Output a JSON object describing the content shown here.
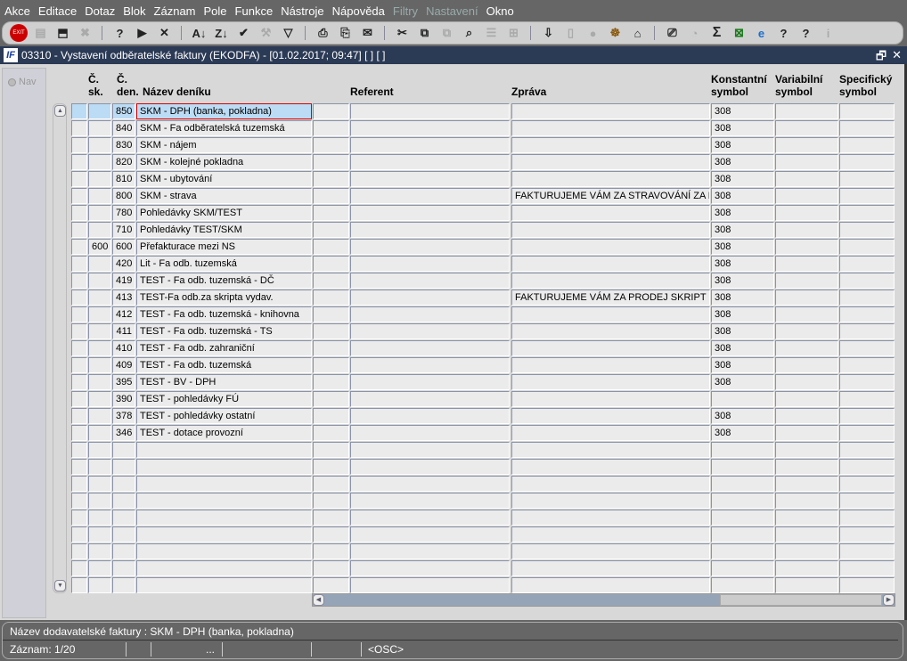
{
  "menu": [
    "Akce",
    "Editace",
    "Dotaz",
    "Blok",
    "Záznam",
    "Pole",
    "Funkce",
    "Nástroje",
    "Nápověda",
    "Filtry",
    "Nastavení",
    "Okno"
  ],
  "menu_disabled": [
    "Filtry",
    "Nastavení"
  ],
  "toolbar": {
    "exit_label": "EXIT",
    "icons": [
      "insert-record-icon",
      "save-icon",
      "delete-record-icon",
      "|",
      "query-icon",
      "execute-query-icon",
      "cancel-query-icon",
      "|",
      "sort-asc-icon",
      "sort-desc-icon",
      "check-icon",
      "wrench-icon",
      "filter-icon",
      "|",
      "print-icon",
      "print-setup-icon",
      "mail-icon",
      "|",
      "cut-icon",
      "copy-icon",
      "paste-icon",
      "find-icon",
      "tree-icon",
      "tree-expand-icon",
      "|",
      "import-icon",
      "document-icon",
      "globe-icon",
      "wheel-icon",
      "home-alert-icon",
      "|",
      "report-icon",
      "clock-icon",
      "sum-icon",
      "excel-icon",
      "ie-icon",
      "help-icon",
      "context-help-icon",
      "info-icon"
    ]
  },
  "window": {
    "title": "03310 - Vystavení odběratelské faktury (EKODFA) - [01.02.2017; 09:47]  [ ]  [ ]",
    "logo": "IF"
  },
  "nav_label": "Nav",
  "headers": {
    "c_sk": "Č.",
    "c_sk2": "sk.",
    "c_den": "Č.",
    "c_den2": "den.",
    "nazev": "Název deníku",
    "referent": "Referent",
    "zprava": "Zpráva",
    "konst": "Konstantní",
    "konst2": "symbol",
    "var": "Variabilní",
    "var2": "symbol",
    "spec": "Specifický",
    "spec2": "symbol"
  },
  "rows": [
    {
      "sk": "",
      "den": "850",
      "nazev": "SKM - DPH  (banka, pokladna)",
      "zprava": "",
      "konst": "308"
    },
    {
      "sk": "",
      "den": "840",
      "nazev": "SKM - Fa odběratelská tuzemská",
      "zprava": "",
      "konst": "308"
    },
    {
      "sk": "",
      "den": "830",
      "nazev": "SKM - nájem",
      "zprava": "",
      "konst": "308"
    },
    {
      "sk": "",
      "den": "820",
      "nazev": "SKM - kolejné pokladna",
      "zprava": "",
      "konst": "308"
    },
    {
      "sk": "",
      "den": "810",
      "nazev": "SKM - ubytování",
      "zprava": "",
      "konst": "308"
    },
    {
      "sk": "",
      "den": "800",
      "nazev": "SKM - strava",
      "zprava": "FAKTURUJEME VÁM ZA STRAVOVÁNÍ ZA MI",
      "konst": "308"
    },
    {
      "sk": "",
      "den": "780",
      "nazev": "Pohledávky SKM/TEST",
      "zprava": "",
      "konst": "308"
    },
    {
      "sk": "",
      "den": "710",
      "nazev": "Pohledávky TEST/SKM",
      "zprava": "",
      "konst": "308"
    },
    {
      "sk": "600",
      "den": "600",
      "nazev": "Přefakturace mezi NS",
      "zprava": "",
      "konst": "308"
    },
    {
      "sk": "",
      "den": "420",
      "nazev": "Lit - Fa odb. tuzemská",
      "zprava": "",
      "konst": "308"
    },
    {
      "sk": "",
      "den": "419",
      "nazev": "TEST - Fa odb. tuzemská - DČ",
      "zprava": "",
      "konst": "308"
    },
    {
      "sk": "",
      "den": "413",
      "nazev": "TEST-Fa odb.za skripta vydav.",
      "zprava": "FAKTURUJEME VÁM ZA PRODEJ SKRIPT",
      "konst": "308"
    },
    {
      "sk": "",
      "den": "412",
      "nazev": "TEST - Fa odb. tuzemská - knihovna",
      "zprava": "",
      "konst": "308"
    },
    {
      "sk": "",
      "den": "411",
      "nazev": "TEST - Fa odb. tuzemská - TS",
      "zprava": "",
      "konst": "308"
    },
    {
      "sk": "",
      "den": "410",
      "nazev": "TEST - Fa odb. zahraniční",
      "zprava": "",
      "konst": "308"
    },
    {
      "sk": "",
      "den": "409",
      "nazev": "TEST - Fa odb. tuzemská",
      "zprava": "",
      "konst": "308"
    },
    {
      "sk": "",
      "den": "395",
      "nazev": "TEST - BV - DPH",
      "zprava": "",
      "konst": "308"
    },
    {
      "sk": "",
      "den": "390",
      "nazev": "TEST - pohledávky FÚ",
      "zprava": "",
      "konst": ""
    },
    {
      "sk": "",
      "den": "378",
      "nazev": "TEST - pohledávky ostatní",
      "zprava": "",
      "konst": "308"
    },
    {
      "sk": "",
      "den": "346",
      "nazev": "TEST - dotace provozní",
      "zprava": "",
      "konst": "308"
    }
  ],
  "empty_rows": 9,
  "status": {
    "hint": "Název dodavatelské faktury : SKM - DPH  (banka, pokladna)",
    "record": "Záznam: 1/20",
    "ellipsis": "...",
    "mode": "<OSC>"
  },
  "colors": {
    "selected_row": "#bcdcf5",
    "title_bar": "#2b3a55"
  }
}
